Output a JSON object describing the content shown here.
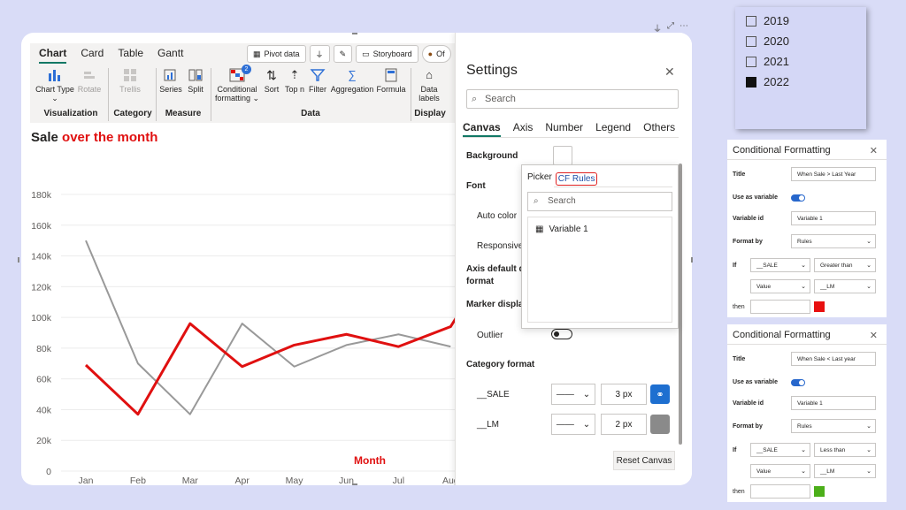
{
  "ribbon": {
    "tabs": [
      "Chart",
      "Card",
      "Table",
      "Gantt"
    ],
    "top_buttons": {
      "pivot": "Pivot data",
      "storyboard": "Storyboard",
      "other": "Of"
    },
    "tools": {
      "chart_type": "Chart Type",
      "rotate": "Rotate",
      "trellis": "Trellis",
      "series": "Series",
      "split": "Split",
      "cond_a": "Conditional",
      "cond_b": "formatting",
      "cond_badge": "2",
      "sort": "Sort",
      "topn": "Top n",
      "filter": "Filter",
      "aggregation": "Aggregation",
      "formula": "Formula",
      "labels_a": "Data",
      "labels_b": "labels"
    },
    "groups": {
      "visualization": "Visualization",
      "category": "Category",
      "measure": "Measure",
      "data": "Data",
      "display": "Display"
    }
  },
  "chart_title": {
    "prefix": "Sale",
    "accent": "over the month"
  },
  "chart_data": {
    "type": "line",
    "x": [
      "Jan",
      "Feb",
      "Mar",
      "Apr",
      "May",
      "Jun",
      "Jul",
      "Aug"
    ],
    "xlabel": "Month",
    "yticks": [
      "0",
      "20k",
      "40k",
      "60k",
      "80k",
      "100k",
      "120k",
      "140k",
      "160k",
      "180k"
    ],
    "ylim": [
      0,
      180000
    ],
    "series": [
      {
        "values": [
          69000,
          37000,
          96000,
          68000,
          82000,
          89000,
          81000,
          94000
        ],
        "color": "#e01010"
      },
      {
        "values": [
          150000,
          70000,
          37000,
          96000,
          68000,
          82000,
          89000,
          81000
        ],
        "color": "#999999"
      }
    ],
    "series_end_value": 105000,
    "colors": {
      "red": "#e01010",
      "gray": "#999999"
    }
  },
  "settings": {
    "title": "Settings",
    "search_placeholder": "Search",
    "tabs": [
      "Canvas",
      "Axis",
      "Number",
      "Legend",
      "Others"
    ],
    "rows": {
      "background": "Background",
      "font": "Font",
      "auto_color": "Auto color",
      "responsive": "Responsive",
      "axis_default_a": "Axis default da",
      "axis_default_b": "format",
      "marker_display": "Marker display",
      "outlier": "Outlier",
      "category_format": "Category format"
    },
    "lines": [
      {
        "name": "__SALE",
        "width": "3 px",
        "color": "#1e6fd0"
      },
      {
        "name": "__LM",
        "width": "2 px",
        "color": "#8a8a8a"
      }
    ],
    "reset": "Reset Canvas"
  },
  "picker": {
    "tab_picker": "Picker",
    "tab_cf": "CF Rules",
    "search_placeholder": "Search",
    "item": "Variable 1"
  },
  "slicer": {
    "years": [
      {
        "label": "2019",
        "checked": false
      },
      {
        "label": "2020",
        "checked": false
      },
      {
        "label": "2021",
        "checked": false
      },
      {
        "label": "2022",
        "checked": true
      }
    ]
  },
  "cf_panels": [
    {
      "title": "Conditional Formatting",
      "labels": {
        "title": "Title",
        "use_var": "Use as variable",
        "var_id": "Variable id",
        "format_by": "Format by",
        "if": "If",
        "then": "then"
      },
      "title_value": "When Sale > Last Year",
      "var_id_value": "Variable 1",
      "format_by_value": "Rules",
      "field": "__SALE",
      "operator": "Greater than",
      "value_type": "Value",
      "compare": "__LM",
      "color": "#e81010"
    },
    {
      "title": "Conditional Formatting",
      "labels": {
        "title": "Title",
        "use_var": "Use as variable",
        "var_id": "Variable id",
        "format_by": "Format by",
        "if": "If",
        "then": "then"
      },
      "title_value": "When Sale < Last year",
      "var_id_value": "Variable 1",
      "format_by_value": "Rules",
      "field": "__SALE",
      "operator": "Less than",
      "value_type": "Value",
      "compare": "__LM",
      "color": "#4caf1a"
    }
  ]
}
